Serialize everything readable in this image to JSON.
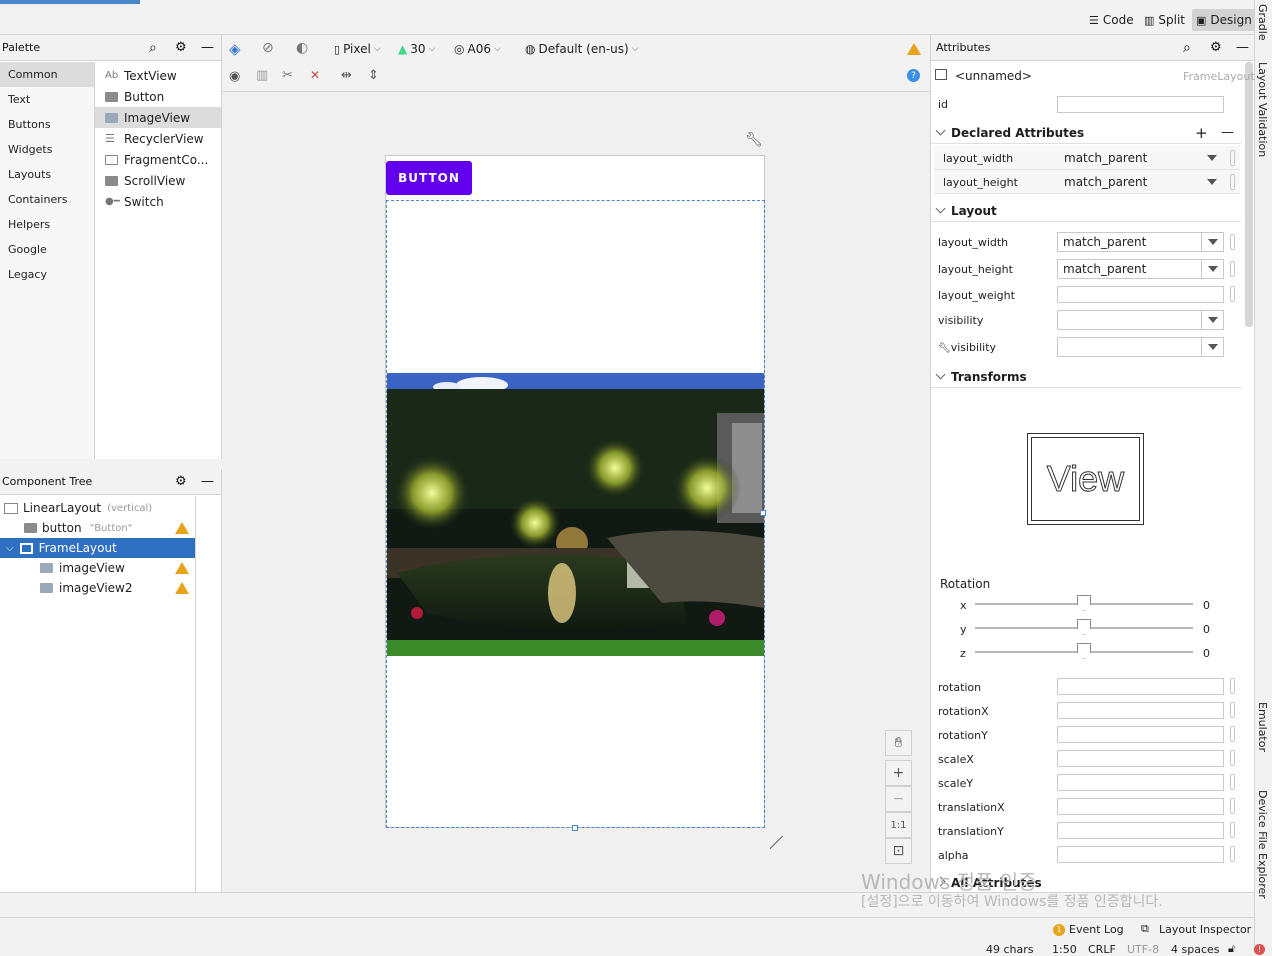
{
  "top_bar": {
    "code_label": "Code",
    "split_label": "Split",
    "design_label": "Design"
  },
  "side_tabs": {
    "gradle": "Gradle",
    "layout_validation": "Layout Validation",
    "emulator": "Emulator",
    "device_file_explorer": "Device File Explorer"
  },
  "palette": {
    "title": "Palette",
    "categories": [
      "Common",
      "Text",
      "Buttons",
      "Widgets",
      "Layouts",
      "Containers",
      "Helpers",
      "Google",
      "Legacy"
    ],
    "items": [
      {
        "prefix": "Ab",
        "label": "TextView"
      },
      {
        "label": "Button"
      },
      {
        "label": "ImageView"
      },
      {
        "label": "RecyclerView"
      },
      {
        "label": "FragmentCo..."
      },
      {
        "label": "ScrollView"
      },
      {
        "label": "Switch"
      }
    ]
  },
  "component_tree": {
    "title": "Component Tree",
    "rows": [
      {
        "label": "LinearLayout",
        "hint": "(vertical)"
      },
      {
        "label": "button",
        "hint": "\"Button\""
      },
      {
        "label": "FrameLayout",
        "hint": ""
      },
      {
        "label": "imageView",
        "hint": ""
      },
      {
        "label": "imageView2",
        "hint": ""
      }
    ]
  },
  "design_toolbar": {
    "device": "Pixel",
    "api": "30",
    "theme": "A06",
    "locale": "Default (en-us)"
  },
  "canvas": {
    "button_label": "BUTTON"
  },
  "zoom": {
    "one_to_one": "1:1"
  },
  "attributes": {
    "title": "Attributes",
    "component_name": "<unnamed>",
    "component_type": "FrameLayout",
    "id_label": "id",
    "declared": {
      "title": "Declared Attributes",
      "rows": [
        {
          "name": "layout_width",
          "value": "match_parent"
        },
        {
          "name": "layout_height",
          "value": "match_parent"
        }
      ]
    },
    "layout": {
      "title": "Layout",
      "rows": [
        {
          "name": "layout_width",
          "value": "match_parent"
        },
        {
          "name": "layout_height",
          "value": "match_parent"
        },
        {
          "name": "layout_weight",
          "value": ""
        },
        {
          "name": "visibility",
          "value": ""
        },
        {
          "name": "visibility",
          "value": ""
        }
      ]
    },
    "transforms": {
      "title": "Transforms",
      "view_label": "View",
      "rotation_label": "Rotation",
      "axes": [
        {
          "name": "x",
          "value": "0"
        },
        {
          "name": "y",
          "value": "0"
        },
        {
          "name": "z",
          "value": "0"
        }
      ],
      "fields": [
        "rotation",
        "rotationX",
        "rotationY",
        "scaleX",
        "scaleY",
        "translationX",
        "translationY",
        "alpha"
      ]
    },
    "all_attributes": "All Attributes"
  },
  "watermark": {
    "line1": "Windows 정품 인증",
    "line2": "[설정]으로 이동하여 Windows를 정품 인증합니다."
  },
  "status": {
    "event_log": "Event Log",
    "layout_inspector": "Layout Inspector",
    "chars": "49 chars",
    "pos": "1:50",
    "eol": "CRLF",
    "encoding": "UTF-8",
    "indent": "4 spaces",
    "event_count": "1"
  },
  "colors": {
    "accent": "#6200ee",
    "selection": "#2f6fbf",
    "warning": "#e8a317"
  }
}
